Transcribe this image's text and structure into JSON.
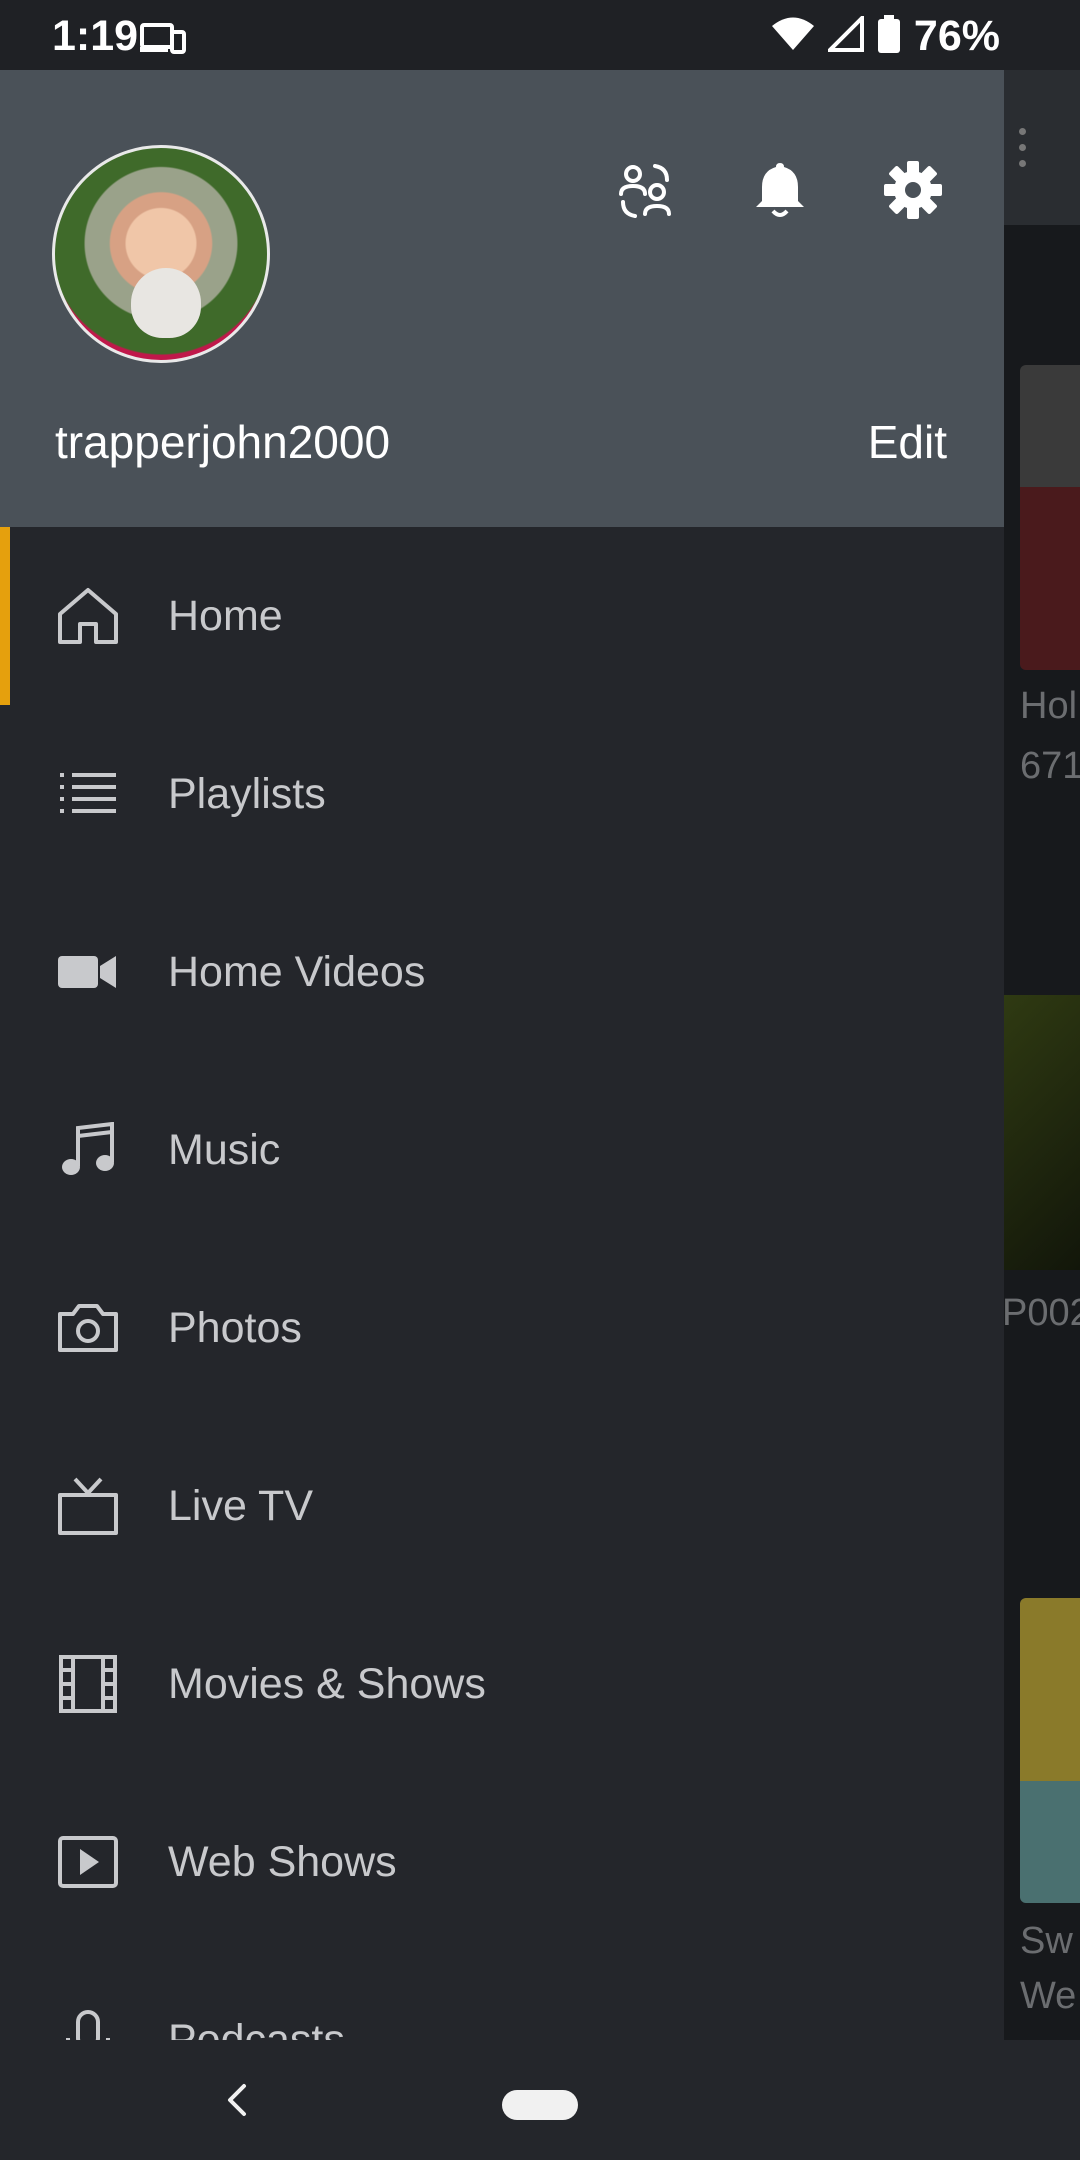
{
  "status_bar": {
    "time": "1:19",
    "battery_percent": "76%"
  },
  "drawer": {
    "username": "trapperjohn2000",
    "edit_label": "Edit",
    "accent_color": "#e5a00d",
    "items": [
      {
        "label": "Home",
        "icon": "home-icon",
        "active": true
      },
      {
        "label": "Playlists",
        "icon": "list-icon",
        "active": false
      },
      {
        "label": "Home Videos",
        "icon": "video-camera-icon",
        "active": false
      },
      {
        "label": "Music",
        "icon": "music-note-icon",
        "active": false
      },
      {
        "label": "Photos",
        "icon": "camera-icon",
        "active": false
      },
      {
        "label": "Live TV",
        "icon": "tv-icon",
        "active": false
      },
      {
        "label": "Movies & Shows",
        "icon": "film-icon",
        "active": false
      },
      {
        "label": "Web Shows",
        "icon": "play-box-icon",
        "active": false
      },
      {
        "label": "Podcasts",
        "icon": "microphone-icon",
        "active": false
      }
    ]
  },
  "background": {
    "texts": [
      "Hol",
      "671",
      "P002",
      "Sw",
      "We"
    ]
  }
}
